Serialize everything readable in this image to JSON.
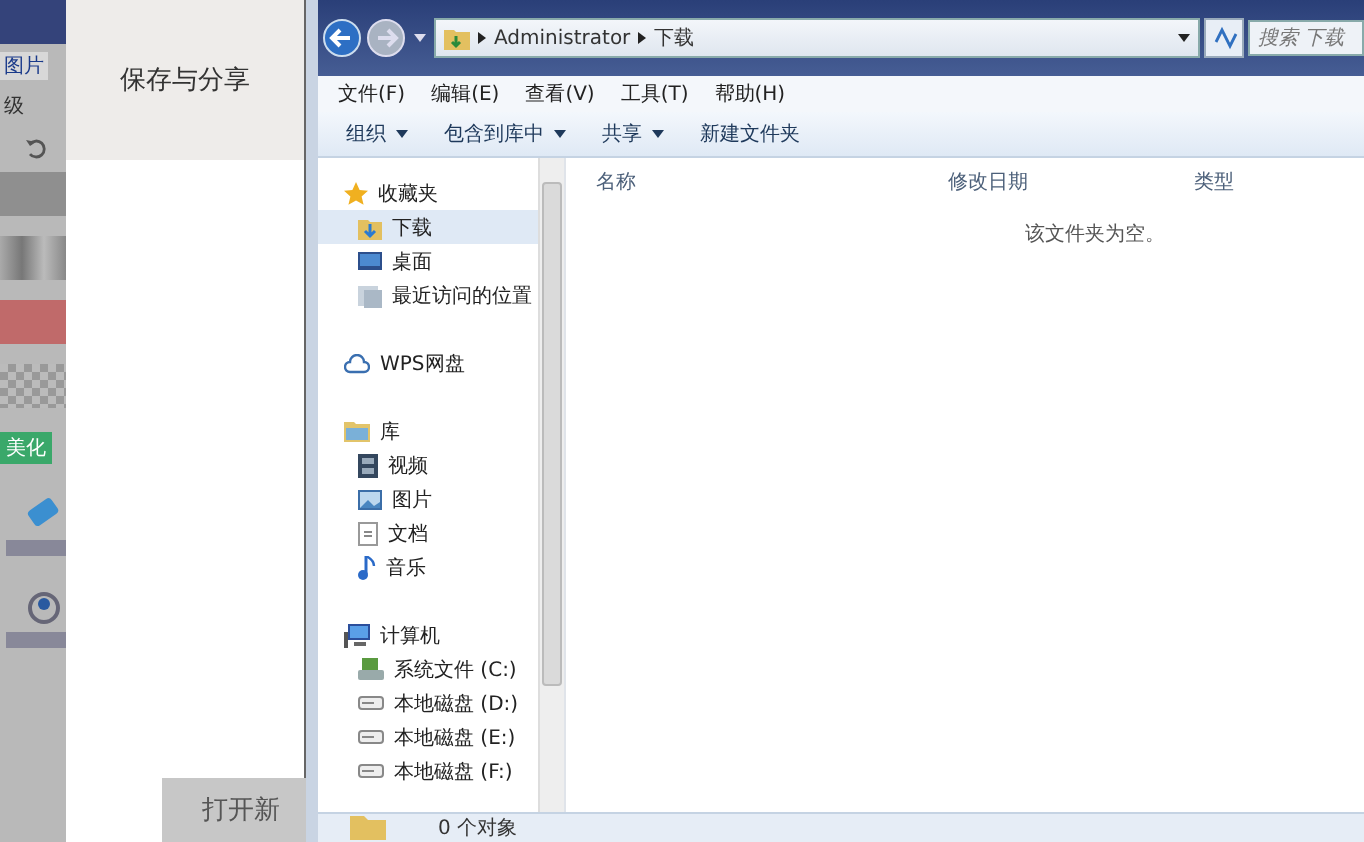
{
  "background_app": {
    "tabs": [
      {
        "label": "图片",
        "selected": true
      },
      {
        "label": "级",
        "selected": false
      }
    ],
    "tag": "美化",
    "panel_title": "保存与分享",
    "button": "打开新"
  },
  "explorer": {
    "address": {
      "path": [
        "Administrator",
        "下载"
      ]
    },
    "search": {
      "placeholder": "搜索 下载"
    },
    "menu": [
      "文件(F)",
      "编辑(E)",
      "查看(V)",
      "工具(T)",
      "帮助(H)"
    ],
    "toolbar": [
      {
        "label": "组织",
        "dropdown": true
      },
      {
        "label": "包含到库中",
        "dropdown": true
      },
      {
        "label": "共享",
        "dropdown": true
      },
      {
        "label": "新建文件夹",
        "dropdown": false
      }
    ],
    "nav": [
      {
        "label": "收藏夹",
        "kind": "star",
        "selected": false,
        "children": [
          {
            "label": "下载",
            "kind": "download",
            "selected": true
          },
          {
            "label": "桌面",
            "kind": "desktop",
            "selected": false
          },
          {
            "label": "最近访问的位置",
            "kind": "recent",
            "selected": false
          }
        ]
      },
      {
        "label": "WPS网盘",
        "kind": "cloud",
        "selected": false
      },
      {
        "label": "库",
        "kind": "library",
        "selected": false,
        "children": [
          {
            "label": "视频",
            "kind": "video",
            "selected": false
          },
          {
            "label": "图片",
            "kind": "picture",
            "selected": false
          },
          {
            "label": "文档",
            "kind": "document",
            "selected": false
          },
          {
            "label": "音乐",
            "kind": "music",
            "selected": false
          }
        ]
      },
      {
        "label": "计算机",
        "kind": "computer",
        "selected": false,
        "children": [
          {
            "label": "系统文件 (C:)",
            "kind": "system-drive",
            "selected": false
          },
          {
            "label": "本地磁盘 (D:)",
            "kind": "drive",
            "selected": false
          },
          {
            "label": "本地磁盘 (E:)",
            "kind": "drive",
            "selected": false
          },
          {
            "label": "本地磁盘 (F:)",
            "kind": "drive",
            "selected": false
          }
        ]
      }
    ],
    "columns": [
      "名称",
      "修改日期",
      "类型"
    ],
    "empty_message": "该文件夹为空。",
    "status": "0 个对象"
  }
}
